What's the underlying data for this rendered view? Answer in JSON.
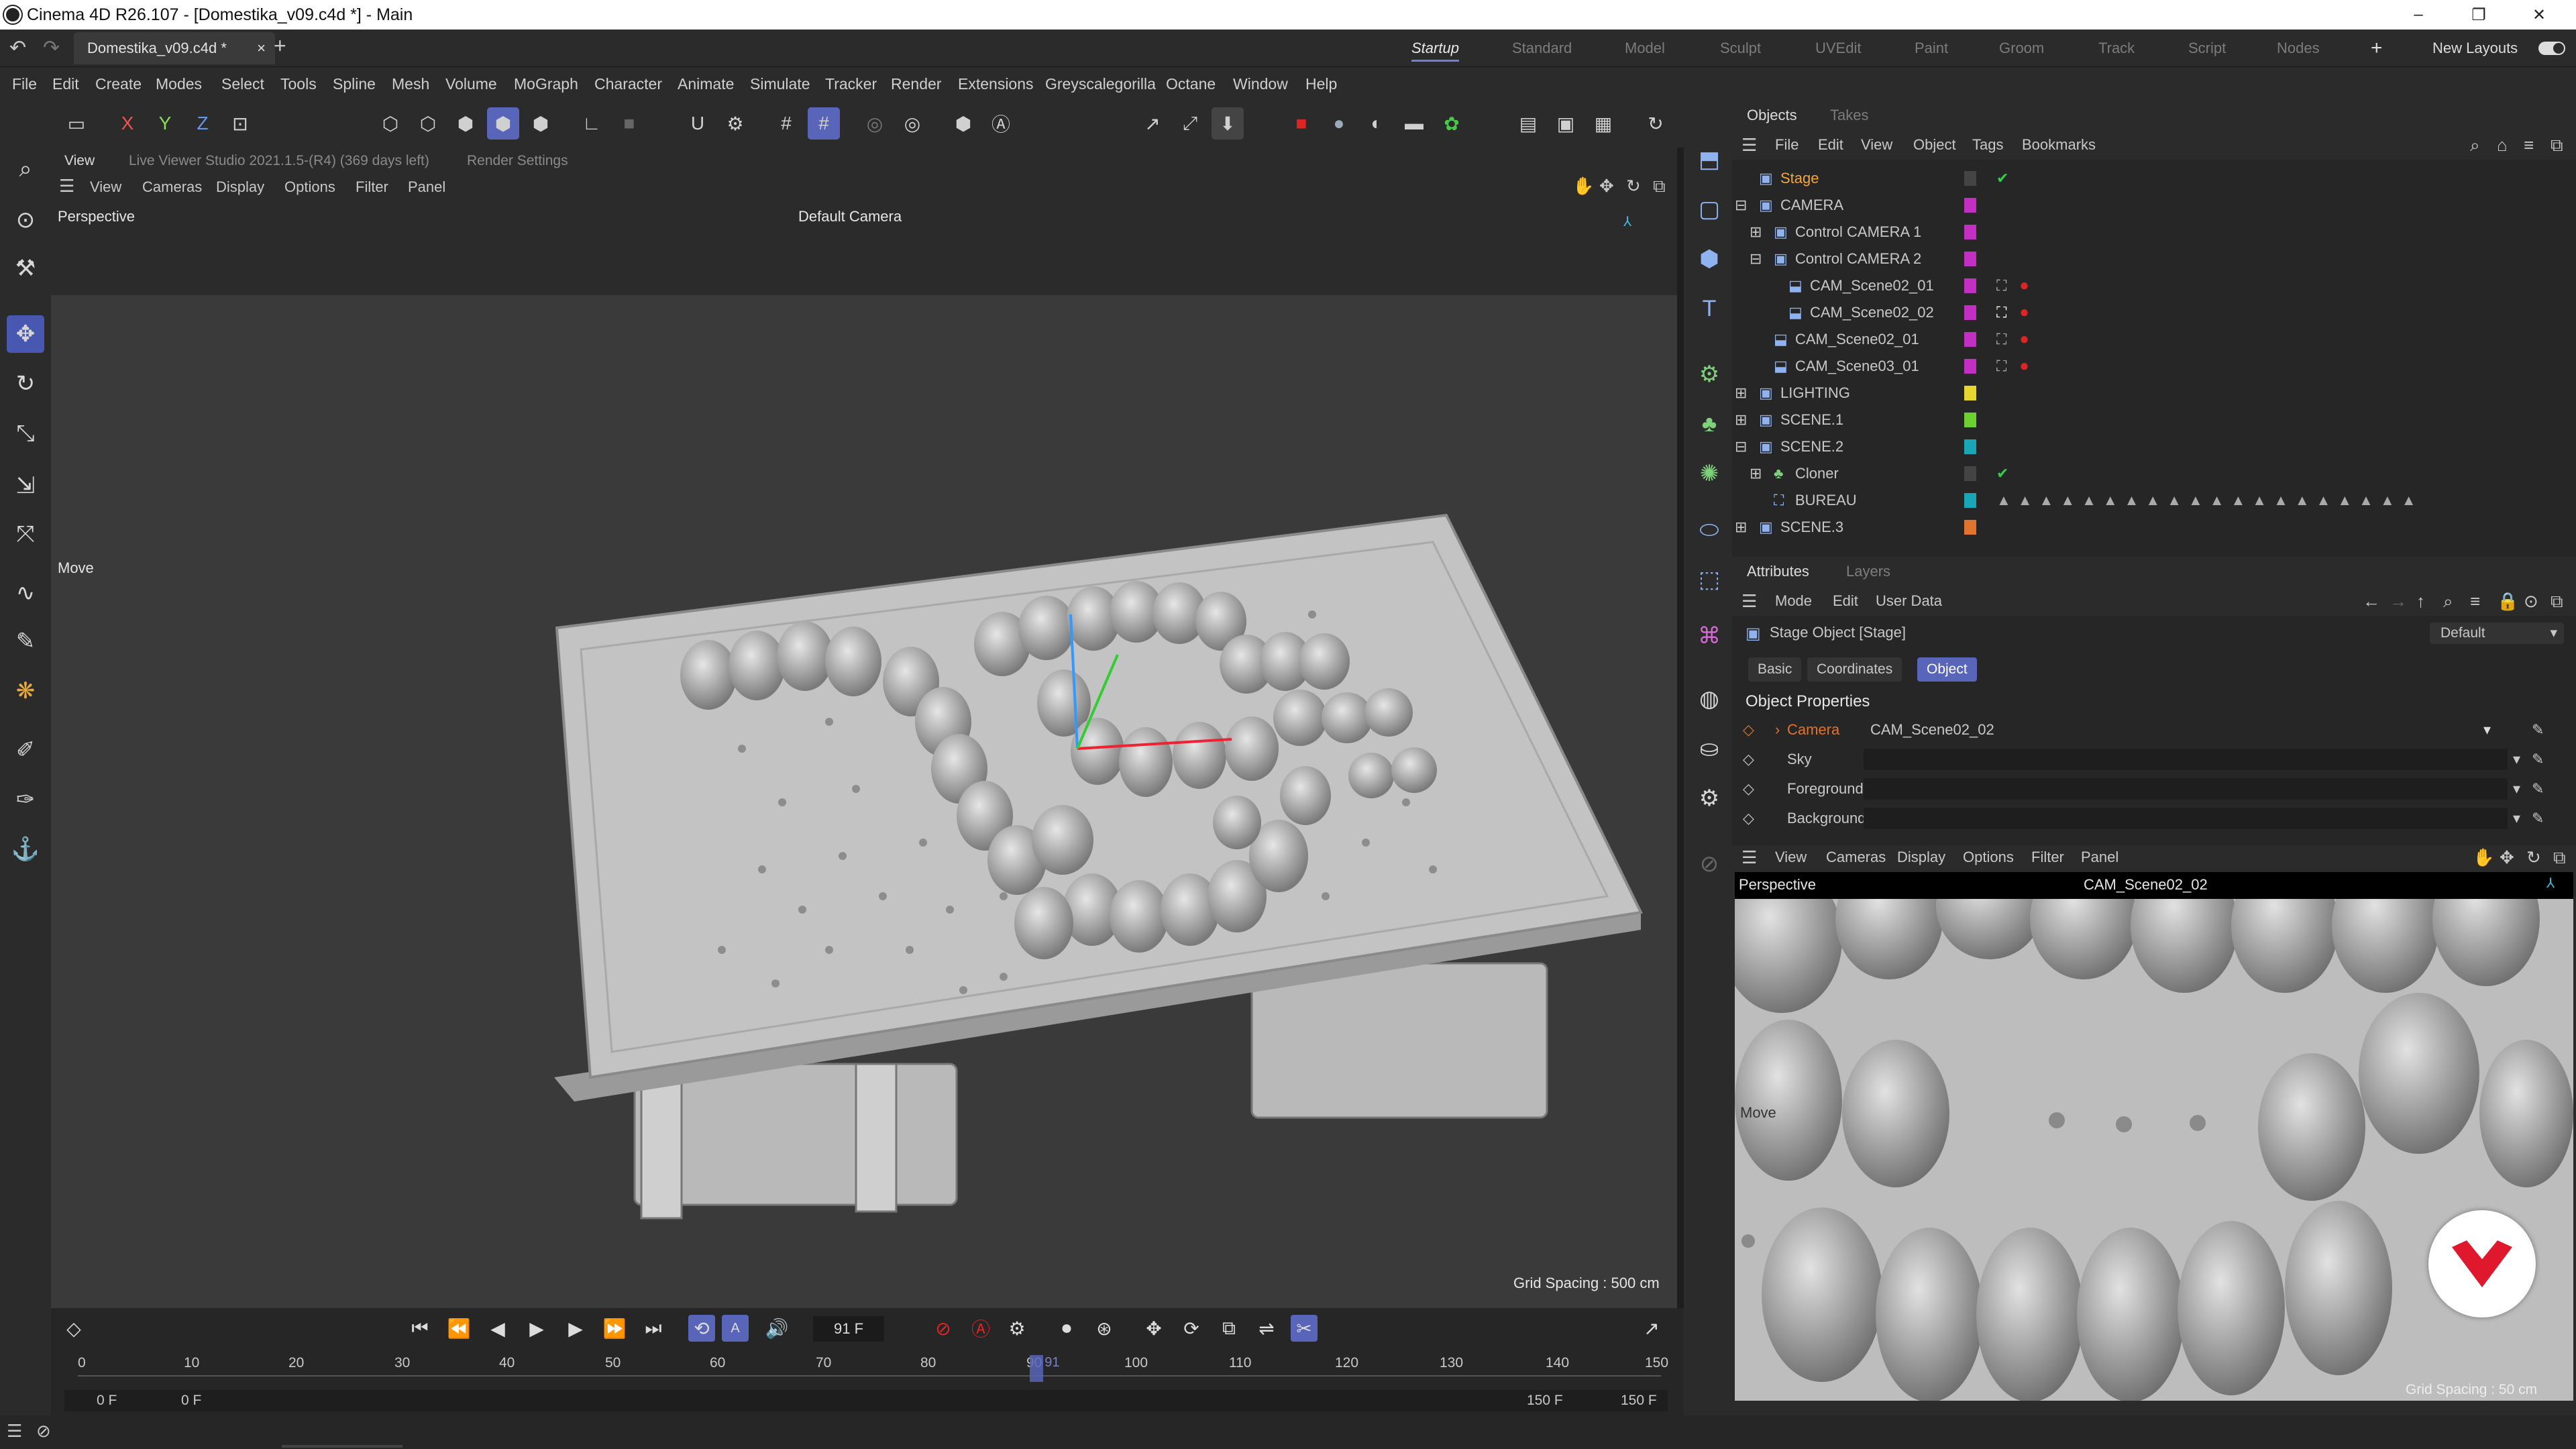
{
  "window": {
    "title": "Cinema 4D R26.107 - [Domestika_v09.c4d *] - Main",
    "min_icon": "minimize-icon",
    "max_icon": "maximize-icon",
    "close_icon": "close-icon"
  },
  "tabs": {
    "doc": "Domestika_v09.c4d *",
    "close": "×",
    "add": "+"
  },
  "layouts": {
    "items": [
      "Startup",
      "Standard",
      "Model",
      "Sculpt",
      "UVEdit",
      "Paint",
      "Groom",
      "Track",
      "Script",
      "Nodes"
    ],
    "new_layouts": "New Layouts",
    "plus": "+"
  },
  "menu": [
    "File",
    "Edit",
    "Create",
    "Modes",
    "Select",
    "Tools",
    "Spline",
    "Mesh",
    "Volume",
    "MoGraph",
    "Character",
    "Animate",
    "Simulate",
    "Tracker",
    "Render",
    "Extensions",
    "Greyscalegorilla",
    "Octane",
    "Window",
    "Help"
  ],
  "axes": {
    "x": "X",
    "y": "Y",
    "z": "Z"
  },
  "viewer": {
    "tab": "View",
    "studio": "Live Viewer Studio 2021.1.5-(R4) (369 days left)",
    "render_settings": "Render Settings"
  },
  "vp_menu": [
    "View",
    "Cameras",
    "Display",
    "Options",
    "Filter",
    "Panel"
  ],
  "viewport": {
    "label": "Perspective",
    "camera": "Default Camera",
    "move": "Move",
    "grid": "Grid Spacing : 500 cm"
  },
  "timeline": {
    "frame": "91 F",
    "ticks": [
      "0",
      "10",
      "20",
      "30",
      "40",
      "50",
      "60",
      "70",
      "80",
      "90",
      "100",
      "110",
      "120",
      "130",
      "140",
      "150"
    ],
    "cursor": "91",
    "start_a": "0 F",
    "start_b": "0 F",
    "end_a": "150 F",
    "end_b": "150 F",
    "current_frame": 91,
    "max_frame": 150
  },
  "objects": {
    "tabs": [
      "Objects",
      "Takes"
    ],
    "menu": [
      "File",
      "Edit",
      "View",
      "Object",
      "Tags",
      "Bookmarks"
    ],
    "rows": [
      {
        "name": "Stage",
        "color": "#000000",
        "indent": 0
      },
      {
        "name": "CAMERA",
        "color": "#c22fc2",
        "indent": 0
      },
      {
        "name": "Control CAMERA 1",
        "color": "#c22fc2",
        "indent": 1
      },
      {
        "name": "Control CAMERA 2",
        "color": "#c22fc2",
        "indent": 1
      },
      {
        "name": "CAM_Scene02_01",
        "color": "#c22fc2",
        "indent": 2
      },
      {
        "name": "CAM_Scene02_02",
        "color": "#c22fc2",
        "indent": 2
      },
      {
        "name": "CAM_Scene02_01",
        "color": "#c22fc2",
        "indent": 1
      },
      {
        "name": "CAM_Scene03_01",
        "color": "#c22fc2",
        "indent": 1
      },
      {
        "name": "LIGHTING",
        "color": "#e6d630",
        "indent": 0
      },
      {
        "name": "SCENE.1",
        "color": "#6cd030",
        "indent": 0
      },
      {
        "name": "SCENE.2",
        "color": "#19a7b8",
        "indent": 0
      },
      {
        "name": "Cloner",
        "color": "#19a7b8",
        "indent": 1
      },
      {
        "name": "BUREAU",
        "color": "#19a7b8",
        "indent": 1
      },
      {
        "name": "SCENE.3",
        "color": "#e0742c",
        "indent": 0
      }
    ]
  },
  "attributes": {
    "tabs": [
      "Attributes",
      "Layers"
    ],
    "menu": [
      "Mode",
      "Edit",
      "User Data"
    ],
    "object_title": "Stage Object [Stage]",
    "preset": "Default",
    "subtabs": [
      "Basic",
      "Coordinates",
      "Object"
    ],
    "section": "Object Properties",
    "props": [
      {
        "label": "Camera",
        "value": "CAM_Scene02_02"
      },
      {
        "label": "Sky",
        "value": ""
      },
      {
        "label": "Foreground",
        "value": ""
      },
      {
        "label": "Background",
        "value": ""
      }
    ]
  },
  "vp2": {
    "menu": [
      "View",
      "Cameras",
      "Display",
      "Options",
      "Filter",
      "Panel"
    ],
    "label": "Perspective",
    "camera": "CAM_Scene02_02",
    "move": "Move",
    "grid": "Grid Spacing : 50 cm"
  },
  "colors": {
    "accent": "#5865b8",
    "stage_check": "#2fd04a",
    "record": "#e02424",
    "logo": "#e0182d"
  }
}
